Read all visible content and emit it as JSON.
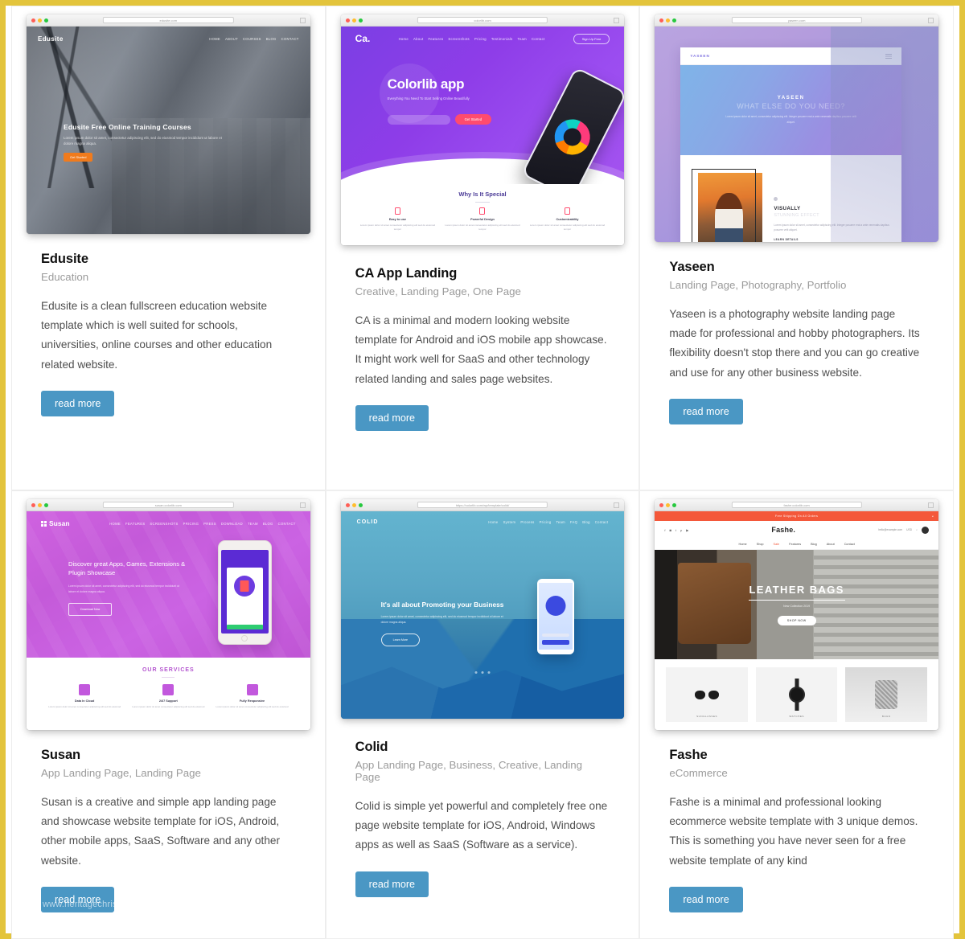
{
  "page": {
    "border_color": "#e3c43c",
    "accent_button_color": "#4a97c4",
    "watermark": "www.heritagechristiancollege.com"
  },
  "cards": [
    {
      "title": "Edusite",
      "categories": "Education",
      "description": "Edusite is a clean fullscreen education website template which is well suited for schools, universities, online courses and other education related website.",
      "read_more": "read more",
      "thumbnail": {
        "url": "edusite.com",
        "logo": "Edusite",
        "nav": [
          "HOME",
          "ABOUT",
          "COURSES",
          "BLOG",
          "CONTACT"
        ],
        "hero_title": "Edusite Free Online Training Courses",
        "hero_sub": "Lorem ipsum dolor sit amet, consectetur adipiscing elit, sed do eiusmod tempor incididunt ut labore et dolore magna aliqua.",
        "hero_button": "Get Started"
      }
    },
    {
      "title": "CA App Landing",
      "categories": "Creative, Landing Page, One Page",
      "description": "CA is a minimal and modern looking website template for Android and iOS mobile app showcase. It might work well for SaaS and other technology related landing and sales page websites.",
      "read_more": "read more",
      "thumbnail": {
        "url": "colorlib.com",
        "logo": "Ca.",
        "nav": [
          "Home",
          "About",
          "Features",
          "Screenshots",
          "Pricing",
          "Testimonials",
          "Team",
          "Contact"
        ],
        "signup": "Sign Up Free",
        "hero_title": "Colorlib app",
        "hero_sub": "Everything You Need To Start Selling Online Beautifully",
        "cta": "Get Started",
        "section_title": "Why Is It Special",
        "features": [
          {
            "name": "Easy to use",
            "text": "Lorem ipsum dolor sit amet consectetur adipiscing elit sed do eiusmod tempor"
          },
          {
            "name": "Powerful Design",
            "text": "Lorem ipsum dolor sit amet consectetur adipiscing elit sed do eiusmod tempor"
          },
          {
            "name": "Customizability",
            "text": "Lorem ipsum dolor sit amet consectetur adipiscing elit sed do eiusmod tempor"
          }
        ]
      }
    },
    {
      "title": "Yaseen",
      "categories": "Landing Page, Photography, Portfolio",
      "description": "Yaseen is a photography website landing page made for professional and hobby photographers. Its flexibility doesn't stop there and you can go creative and use for any other business website.",
      "read_more": "read more",
      "thumbnail": {
        "url": "yaseen.com",
        "logo": "YASEEN",
        "hero_title": "YASEEN",
        "hero_sub": "WHAT ELSE DO YOU NEED?",
        "hero_text": "Lorem ipsum dolor sit amet, consectetur adipiscing elit. Integer posuere erat a ante venenatis dapibus posuere velit aliquet.",
        "section_title": "VISUALLY",
        "section_sub": "STUNNING EFFECT",
        "section_text": "Lorem ipsum dolor sit amet, consectetur adipiscing elit. Integer posuere erat a ante venenatis dapibus posuere velit aliquet.",
        "link": "LEARN DETAILS"
      }
    },
    {
      "title": "Susan",
      "categories": "App Landing Page, Landing Page",
      "description": "Susan is a creative and simple app landing page and showcase website template for iOS, Android, other mobile apps, SaaS, Software and any other website.",
      "read_more": "read more",
      "has_watermark": true,
      "thumbnail": {
        "url": "susan.colorlib.com",
        "logo": "Susan",
        "nav": [
          "HOME",
          "FEATURES",
          "SCREENSHOTS",
          "PRICING",
          "PRESS",
          "DOWNLOAD",
          "TEAM",
          "BLOG",
          "CONTACT"
        ],
        "hero_title": "Discover great Apps, Games, Extensions & Plugin Showcase",
        "hero_sub": "Lorem ipsum dolor sit amet, consectetur adipiscing elit, sed do eiusmod tempor incididunt ut labore et dolore magna aliqua.",
        "hero_button": "Download Now",
        "section_title": "OUR SERVICES",
        "services": [
          {
            "name": "Data In Cloud",
            "text": "Lorem ipsum dolor sit amet consectetur adipiscing elit sed do eiusmod"
          },
          {
            "name": "24/7 Support",
            "text": "Lorem ipsum dolor sit amet consectetur adipiscing elit sed do eiusmod"
          },
          {
            "name": "Fully Responsive",
            "text": "Lorem ipsum dolor sit amet consectetur adipiscing elit sed do eiusmod"
          }
        ]
      }
    },
    {
      "title": "Colid",
      "categories": "App Landing Page, Business, Creative, Landing Page",
      "description": "Colid is simple yet powerful and completely free one page website template for iOS, Android, Windows apps as well as SaaS (Software as a service).",
      "read_more": "read more",
      "thumbnail": {
        "url": "https://colorlib.com/wp/template/colid/",
        "logo": "COLID",
        "nav": [
          "Home",
          "System",
          "Process",
          "Pricing",
          "Team",
          "FAQ",
          "Blog",
          "Contact"
        ],
        "hero_title": "It's all about Promoting your Business",
        "hero_sub": "Lorem ipsum dolor sit amet, consectetur adipiscing elit, sed do eiusmod tempor incididunt ut labore et dolore magna aliqua.",
        "hero_button": "Learn More"
      }
    },
    {
      "title": "Fashe",
      "categories": "eCommerce",
      "description": "Fashe is a minimal and professional looking ecommerce website template with 3 unique demos. This is something you have never seen for a free website template of any kind",
      "read_more": "read more",
      "thumbnail": {
        "url": "fashe.colorlib.com",
        "banner": "Free Shipping On All Orders",
        "banner_close": "×",
        "logo": "Fashe.",
        "account": "hello@example.com",
        "lang": "USD",
        "nav": [
          "Home",
          "Shop",
          "Sale",
          "Features",
          "Blog",
          "About",
          "Contact"
        ],
        "active_nav": "Sale",
        "hero_title": "LEATHER BAGS",
        "hero_sub": "New Collection 2019",
        "hero_button": "SHOP NOW",
        "products": [
          {
            "caption": "SUNGLASSES"
          },
          {
            "caption": "WATCHES"
          },
          {
            "caption": "BAGS"
          }
        ]
      }
    }
  ]
}
